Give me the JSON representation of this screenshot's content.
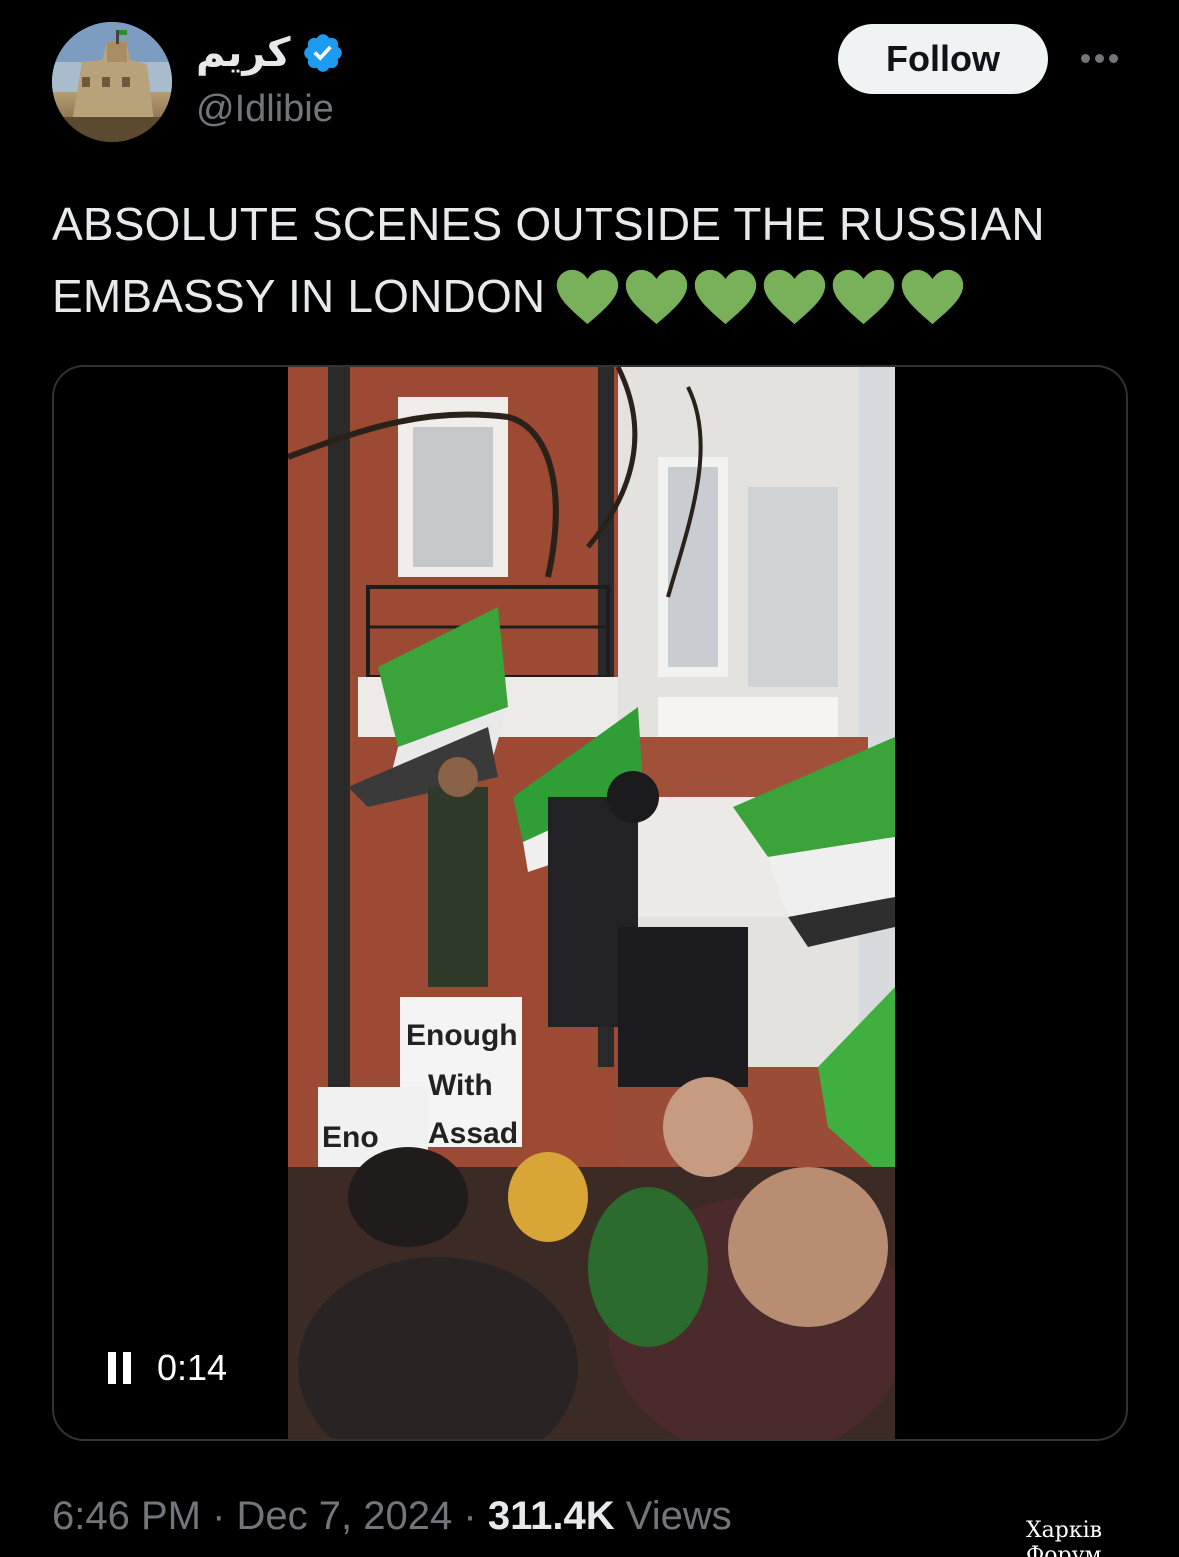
{
  "author": {
    "display_name": "كريم",
    "handle": "@Idlibie",
    "verified": true,
    "avatar_icon": "castle-avatar-icon",
    "badge_color": "#1d9bf0"
  },
  "actions": {
    "follow_label": "Follow",
    "more_icon": "more-dots-icon"
  },
  "tweet": {
    "text": "ABSOLUTE SCENES OUTSIDE THE RUSSIAN EMBASSY IN LONDON",
    "emoji_icon": "green-heart-icon",
    "emoji_count": 6,
    "emoji_color": "#78b159"
  },
  "media": {
    "type": "video",
    "playback_state_icon": "pause-icon",
    "elapsed_time": "0:14",
    "sign_texts": [
      "Enough",
      "With",
      "Assad",
      "Eno"
    ]
  },
  "meta": {
    "time": "6:46 PM",
    "separator": "·",
    "date": "Dec 7, 2024",
    "views_count": "311.4K",
    "views_label": "Views"
  },
  "watermark": "Харків Форум",
  "colors": {
    "background": "#000000",
    "text_primary": "#e7e9ea",
    "text_secondary": "#71767b",
    "border": "#2f3336"
  }
}
